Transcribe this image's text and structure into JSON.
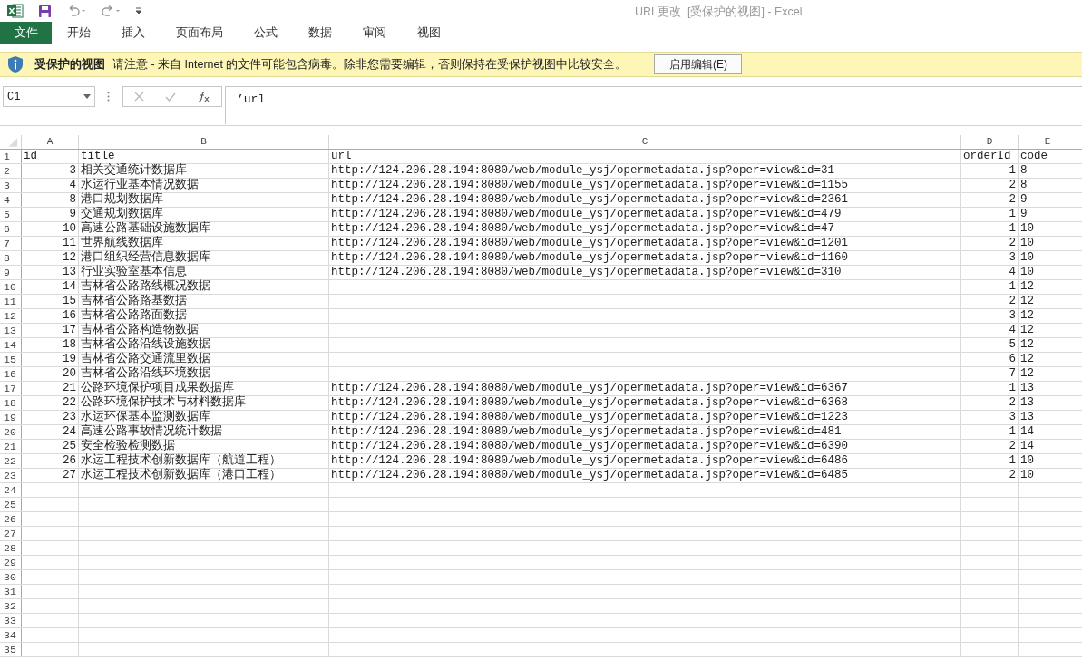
{
  "window": {
    "title": "URL更改  [受保护的视图] - Excel"
  },
  "ribbon_tabs": [
    {
      "label": "文件",
      "kind": "file"
    },
    {
      "label": "开始",
      "kind": "tab"
    },
    {
      "label": "插入",
      "kind": "tab"
    },
    {
      "label": "页面布局",
      "kind": "tab"
    },
    {
      "label": "公式",
      "kind": "tab"
    },
    {
      "label": "数据",
      "kind": "tab"
    },
    {
      "label": "审阅",
      "kind": "tab"
    },
    {
      "label": "视图",
      "kind": "tab"
    }
  ],
  "message_bar": {
    "title": "受保护的视图",
    "text": "请注意 - 来自 Internet 的文件可能包含病毒。除非您需要编辑，否则保持在受保护视图中比较安全。",
    "button": "启用编辑(E)"
  },
  "formula_bar": {
    "name_box": "C1",
    "formula": "’url"
  },
  "sheet": {
    "columns": [
      {
        "header": "A",
        "kind": "number"
      },
      {
        "header": "B",
        "kind": "text"
      },
      {
        "header": "C",
        "kind": "text"
      },
      {
        "header": "D",
        "kind": "number"
      },
      {
        "header": "E",
        "kind": "text"
      }
    ],
    "rows": [
      {
        "number": "1",
        "cells": [
          "id",
          "title",
          "url",
          "orderId",
          "code"
        ],
        "kind": "header"
      },
      {
        "number": "2",
        "cells": [
          "3",
          "相关交通统计数据库",
          "http://124.206.28.194:8080/web/module_ysj/opermetadata.jsp?oper=view&id=31",
          "1",
          "8"
        ],
        "kind": "data"
      },
      {
        "number": "3",
        "cells": [
          "4",
          "水运行业基本情况数据",
          "http://124.206.28.194:8080/web/module_ysj/opermetadata.jsp?oper=view&id=1155",
          "2",
          "8"
        ],
        "kind": "data"
      },
      {
        "number": "4",
        "cells": [
          "8",
          "港口规划数据库",
          "http://124.206.28.194:8080/web/module_ysj/opermetadata.jsp?oper=view&id=2361",
          "2",
          "9"
        ],
        "kind": "data"
      },
      {
        "number": "5",
        "cells": [
          "9",
          "交通规划数据库",
          "http://124.206.28.194:8080/web/module_ysj/opermetadata.jsp?oper=view&id=479",
          "1",
          "9"
        ],
        "kind": "data"
      },
      {
        "number": "6",
        "cells": [
          "10",
          "高速公路基础设施数据库",
          "http://124.206.28.194:8080/web/module_ysj/opermetadata.jsp?oper=view&id=47",
          "1",
          "10"
        ],
        "kind": "data"
      },
      {
        "number": "7",
        "cells": [
          "11",
          "世界航线数据库",
          "http://124.206.28.194:8080/web/module_ysj/opermetadata.jsp?oper=view&id=1201",
          "2",
          "10"
        ],
        "kind": "data"
      },
      {
        "number": "8",
        "cells": [
          "12",
          "港口组织经营信息数据库",
          "http://124.206.28.194:8080/web/module_ysj/opermetadata.jsp?oper=view&id=1160",
          "3",
          "10"
        ],
        "kind": "data"
      },
      {
        "number": "9",
        "cells": [
          "13",
          "行业实验室基本信息",
          "http://124.206.28.194:8080/web/module_ysj/opermetadata.jsp?oper=view&id=310",
          "4",
          "10"
        ],
        "kind": "data"
      },
      {
        "number": "10",
        "cells": [
          "14",
          "吉林省公路路线概况数据",
          null,
          "1",
          "12"
        ],
        "kind": "data"
      },
      {
        "number": "11",
        "cells": [
          "15",
          "吉林省公路路基数据",
          null,
          "2",
          "12"
        ],
        "kind": "data"
      },
      {
        "number": "12",
        "cells": [
          "16",
          "吉林省公路路面数据",
          null,
          "3",
          "12"
        ],
        "kind": "data"
      },
      {
        "number": "13",
        "cells": [
          "17",
          "吉林省公路构造物数据",
          null,
          "4",
          "12"
        ],
        "kind": "data"
      },
      {
        "number": "14",
        "cells": [
          "18",
          "吉林省公路沿线设施数据",
          null,
          "5",
          "12"
        ],
        "kind": "data"
      },
      {
        "number": "15",
        "cells": [
          "19",
          "吉林省公路交通流里数据",
          null,
          "6",
          "12"
        ],
        "kind": "data"
      },
      {
        "number": "16",
        "cells": [
          "20",
          "吉林省公路沿线环境数据",
          null,
          "7",
          "12"
        ],
        "kind": "data"
      },
      {
        "number": "17",
        "cells": [
          "21",
          "公路环境保护项目成果数据库",
          "http://124.206.28.194:8080/web/module_ysj/opermetadata.jsp?oper=view&id=6367",
          "1",
          "13"
        ],
        "kind": "data"
      },
      {
        "number": "18",
        "cells": [
          "22",
          "公路环境保护技术与材料数据库",
          "http://124.206.28.194:8080/web/module_ysj/opermetadata.jsp?oper=view&id=6368",
          "2",
          "13"
        ],
        "kind": "data"
      },
      {
        "number": "19",
        "cells": [
          "23",
          "水运环保基本监测数据库",
          "http://124.206.28.194:8080/web/module_ysj/opermetadata.jsp?oper=view&id=1223",
          "3",
          "13"
        ],
        "kind": "data"
      },
      {
        "number": "20",
        "cells": [
          "24",
          "高速公路事故情况统计数据",
          "http://124.206.28.194:8080/web/module_ysj/opermetadata.jsp?oper=view&id=481",
          "1",
          "14"
        ],
        "kind": "data"
      },
      {
        "number": "21",
        "cells": [
          "25",
          "安全检验检测数据",
          "http://124.206.28.194:8080/web/module_ysj/opermetadata.jsp?oper=view&id=6390",
          "2",
          "14"
        ],
        "kind": "data"
      },
      {
        "number": "22",
        "cells": [
          "26",
          "水运工程技术创新数据库（航道工程）",
          "http://124.206.28.194:8080/web/module_ysj/opermetadata.jsp?oper=view&id=6486",
          "1",
          "10"
        ],
        "kind": "data"
      },
      {
        "number": "23",
        "cells": [
          "27",
          "水运工程技术创新数据库（港口工程）",
          "http://124.206.28.194:8080/web/module_ysj/opermetadata.jsp?oper=view&id=6485",
          "2",
          "10"
        ],
        "kind": "data"
      },
      {
        "number": "24"
      },
      {
        "number": "25"
      },
      {
        "number": "26"
      },
      {
        "number": "27"
      },
      {
        "number": "28"
      },
      {
        "number": "29"
      },
      {
        "number": "30"
      },
      {
        "number": "31"
      },
      {
        "number": "32"
      },
      {
        "number": "33"
      },
      {
        "number": "34"
      },
      {
        "number": "35"
      }
    ]
  }
}
